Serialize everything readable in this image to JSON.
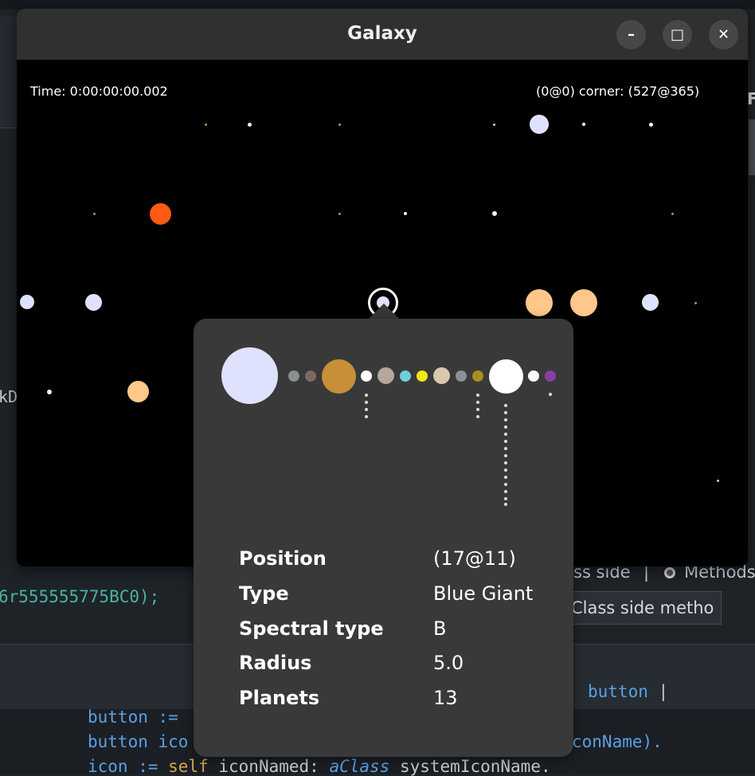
{
  "window": {
    "title": "Galaxy",
    "minimize_label": "–",
    "maximize_label": "□",
    "close_label": "✕"
  },
  "hud": {
    "time": "Time: 0:00:00:00.002",
    "corner": "(0@0) corner: (527@365)"
  },
  "popover": {
    "rows": [
      {
        "label": "Position",
        "value": "(17@11)"
      },
      {
        "label": "Type",
        "value": "Blue Giant"
      },
      {
        "label": "Spectral type",
        "value": "B"
      },
      {
        "label": "Radius",
        "value": "5.0"
      },
      {
        "label": "Planets",
        "value": "13"
      }
    ],
    "star_color": "#dfe2ff",
    "planet_colors": [
      "#8a9090",
      "#7a6a60",
      "#c88e38",
      "#ffffff",
      "#b7a69b",
      "#6fcfd8",
      "#f0e619",
      "#d9c7b0",
      "#8a9096",
      "#a88e22",
      "#ffffff",
      "#ffffff",
      "#8a3fa0"
    ]
  },
  "background": {
    "code_line_1": "6r555555775BC0);",
    "code_fragment_kd": "kD",
    "radio_class_side": "ss side",
    "radio_sep": "|",
    "radio_methods": "Methods",
    "tab_class_side_methods": "Class side metho",
    "code_button_var": "button",
    "code_bar": "|",
    "code_line_assign": "button :=",
    "code_line_icon_a": "button ico",
    "code_line_icon_b": "conName).",
    "code_line_icon_c_pre": "icon := ",
    "code_line_icon_c_self": "self",
    "code_line_icon_c_mid": " iconNamed: ",
    "code_line_icon_c_arg": "aClass",
    "code_line_icon_c_end": " systemIconName.",
    "sidebar_letter": "F"
  },
  "colors": {
    "blue_star": "#dfe2ff",
    "orange_star": "#ffc78a",
    "red_star": "#ff5a14",
    "accent_code_blue": "#5aa0e6"
  }
}
